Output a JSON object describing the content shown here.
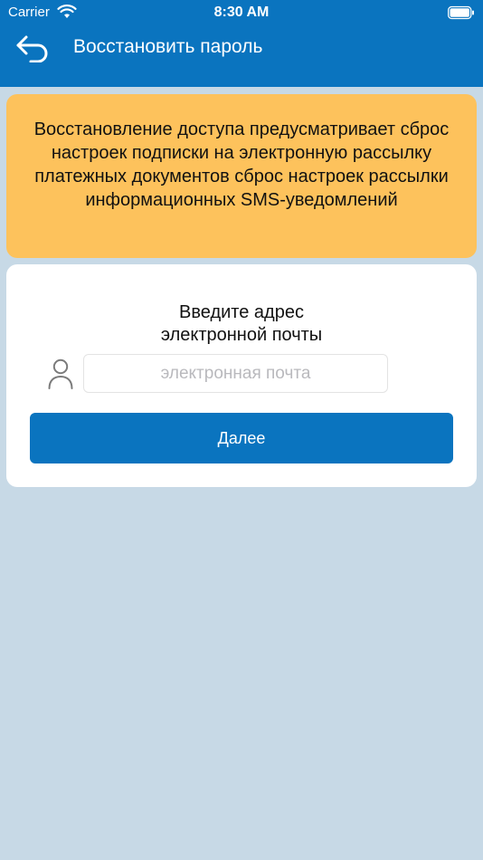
{
  "status_bar": {
    "carrier": "Carrier",
    "time": "8:30 AM"
  },
  "nav": {
    "title": "Восстановить пароль",
    "back_icon": "back-arrow-icon"
  },
  "notice": {
    "text": "Восстановление доступа предусматривает сброс настроек подписки на электронную рассылку платежных документов сброс настроек рассылки информационных SMS-уведомлений"
  },
  "form": {
    "prompt_line1": "Введите адрес",
    "prompt_line2": "электронной почты",
    "email_placeholder": "электронная почта",
    "email_value": "",
    "user_icon": "user-icon",
    "next_label": "Далее"
  },
  "colors": {
    "primary": "#0a74bf",
    "notice_bg": "#fdc25c",
    "page_bg": "#c7d9e6"
  }
}
